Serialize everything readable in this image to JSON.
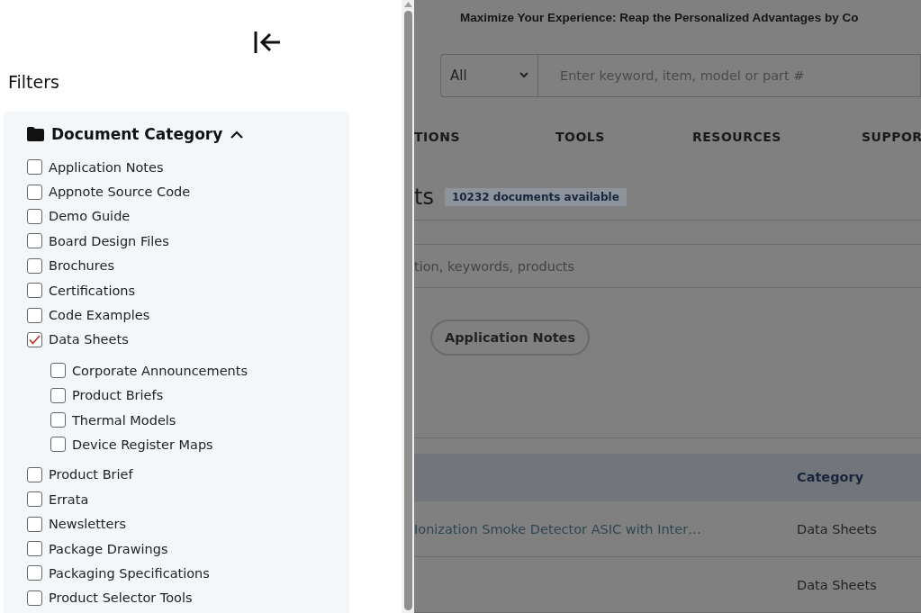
{
  "drawer": {
    "title": "Filters",
    "section": {
      "title": "Document Category",
      "expanded": true,
      "items": [
        {
          "label": "Application Notes",
          "checked": false
        },
        {
          "label": "Appnote Source Code",
          "checked": false
        },
        {
          "label": "Demo Guide",
          "checked": false
        },
        {
          "label": "Board Design Files",
          "checked": false
        },
        {
          "label": "Brochures",
          "checked": false
        },
        {
          "label": "Certifications",
          "checked": false
        },
        {
          "label": "Code Examples",
          "checked": false
        },
        {
          "label": "Data Sheets",
          "checked": true,
          "children": [
            {
              "label": "Corporate Announcements",
              "checked": false
            },
            {
              "label": "Product Briefs",
              "checked": false
            },
            {
              "label": "Thermal Models",
              "checked": false
            },
            {
              "label": "Device Register Maps",
              "checked": false
            }
          ]
        },
        {
          "label": "Product Brief",
          "checked": false
        },
        {
          "label": "Errata",
          "checked": false
        },
        {
          "label": "Newsletters",
          "checked": false
        },
        {
          "label": "Package Drawings",
          "checked": false
        },
        {
          "label": "Packaging Specifications",
          "checked": false
        },
        {
          "label": "Product Selector Tools",
          "checked": false
        }
      ]
    }
  },
  "page": {
    "banner": "Maximize Your Experience: Reap the Personalized Advantages by Co",
    "search": {
      "scope": "All",
      "placeholder": "Enter keyword, item, model or part #"
    },
    "nav": [
      "TIONS",
      "TOOLS",
      "RESOURCES",
      "SUPPOR"
    ],
    "heading": "ts",
    "count_badge": "10232 documents available",
    "filter_placeholder": "tion, keywords, products",
    "chips": [
      "Application Notes"
    ],
    "table": {
      "columns": [
        "Category"
      ],
      "rows": [
        {
          "title": "Ionization Smoke Detector ASIC with Inter…",
          "category": "Data Sheets"
        },
        {
          "title": "",
          "category": "Data Sheets"
        }
      ]
    }
  }
}
